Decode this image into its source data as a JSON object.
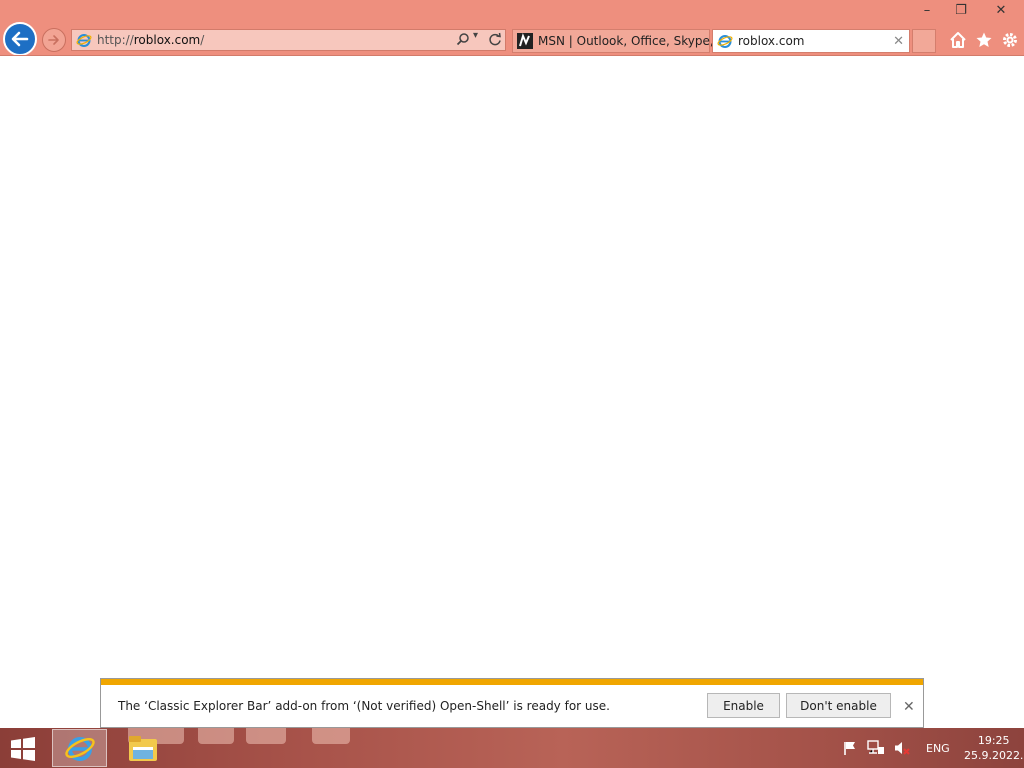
{
  "window": {
    "minimize_glyph": "–",
    "restore_glyph": "❐",
    "close_glyph": "✕"
  },
  "address_bar": {
    "prefix": "http://",
    "domain": "roblox.com",
    "suffix": "/"
  },
  "tabs": [
    {
      "label": "MSN | Outlook, Office, Skype, ...",
      "active": false,
      "icon": "msn-icon"
    },
    {
      "label": "roblox.com",
      "active": true,
      "icon": "ie-icon"
    }
  ],
  "tab_close_glyph": "✕",
  "toolbar": [
    "home-icon",
    "favorites-star-icon",
    "settings-gear-icon"
  ],
  "notification": {
    "message": "The ‘Classic Explorer Bar’ add-on from ‘(Not verified) Open-Shell’ is ready for use.",
    "enable_label": "Enable",
    "dont_enable_label": "Don't enable",
    "close_glyph": "✕"
  },
  "taskbar": {
    "pinned": [
      "internet-explorer-icon",
      "file-explorer-icon"
    ],
    "tray": {
      "language": "ENG",
      "time": "19:25",
      "date": "25.9.2022."
    }
  },
  "colors": {
    "chrome": "#ee8f7e",
    "notification_strip": "#f0a600",
    "back_button": "#1e6fc4"
  }
}
